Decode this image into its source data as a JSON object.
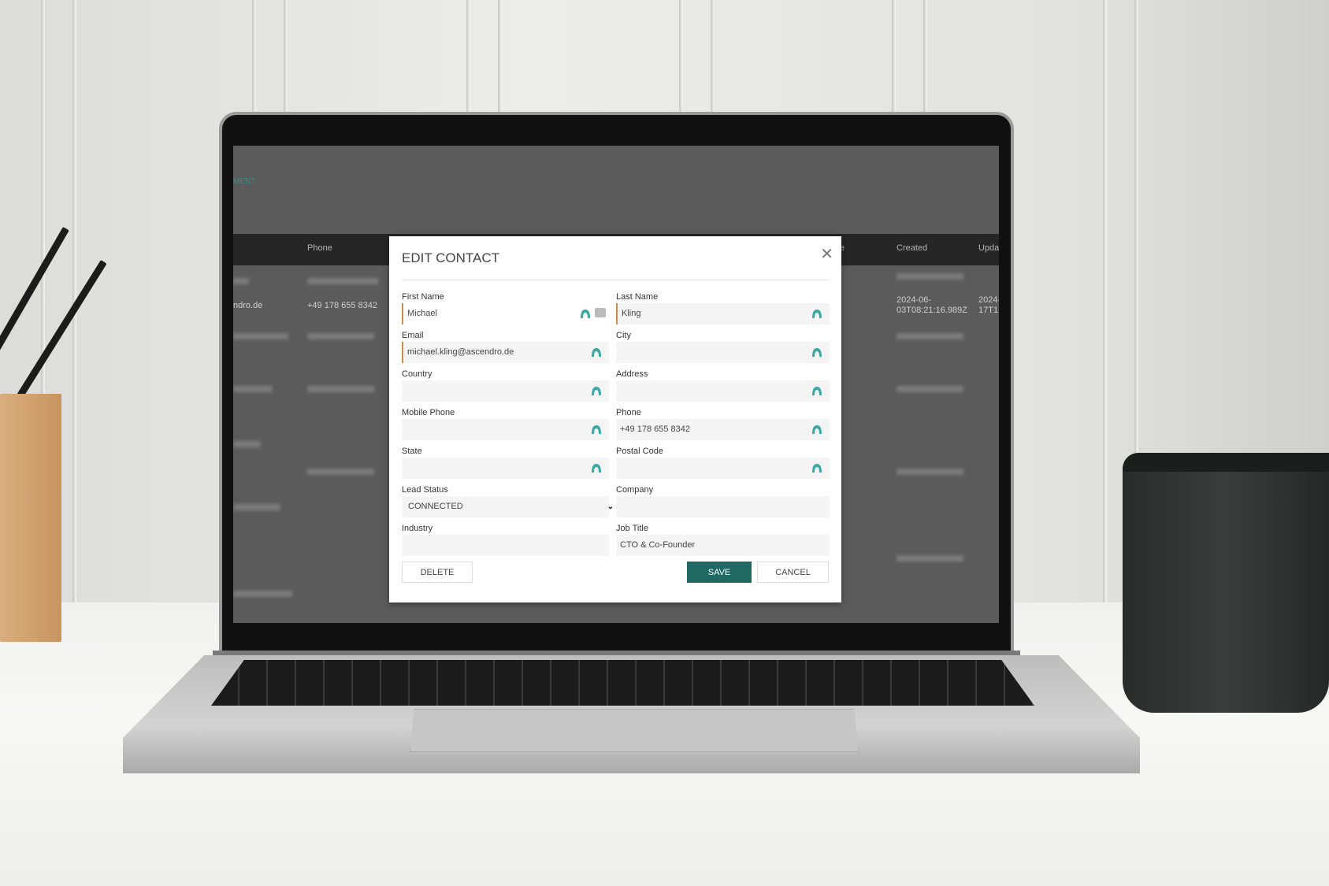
{
  "background_app": {
    "nav_link": "MENT",
    "table_headers": [
      "Phone",
      "e",
      "Created",
      "Upda"
    ],
    "row": {
      "email_fragment": "ndro.de",
      "phone": "+49 178 655 8342",
      "created_1": "2024-06-",
      "created_2": "03T08:21:16.989Z",
      "updated_1": "2024-",
      "updated_2": "17T1"
    }
  },
  "dialog": {
    "title": "EDIT CONTACT",
    "close_icon": "close-icon",
    "accent_color": "#1f6864",
    "autofill_icon_color": "#3aa9a4",
    "fields": [
      {
        "label": "First Name",
        "value": "Michael"
      },
      {
        "label": "Last Name",
        "value": "Kling"
      },
      {
        "label": "Email",
        "value": "michael.kling@ascendro.de"
      },
      {
        "label": "City",
        "value": ""
      },
      {
        "label": "Country",
        "value": ""
      },
      {
        "label": "Address",
        "value": ""
      },
      {
        "label": "Mobile Phone",
        "value": ""
      },
      {
        "label": "Phone",
        "value": "+49 178 655 8342"
      },
      {
        "label": "State",
        "value": ""
      },
      {
        "label": "Postal Code",
        "value": ""
      },
      {
        "label": "Lead Status",
        "value": "CONNECTED"
      },
      {
        "label": "Company",
        "value": ""
      },
      {
        "label": "Industry",
        "value": ""
      },
      {
        "label": "Job Title",
        "value": "CTO & Co-Founder"
      }
    ],
    "buttons": {
      "delete": "DELETE",
      "save": "SAVE",
      "cancel": "CANCEL"
    }
  }
}
